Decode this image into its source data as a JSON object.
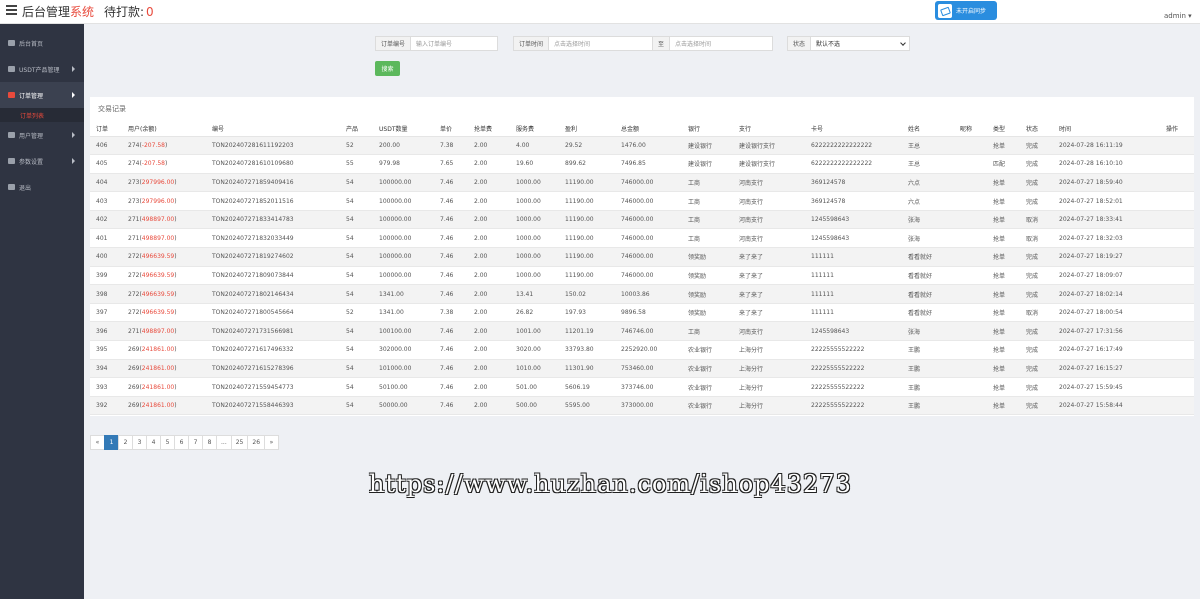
{
  "header": {
    "logo_main": "后台管理",
    "logo_accent": "系统",
    "pending_label": "待打款:",
    "pending_value": "0",
    "sync_label": "未开启同步",
    "user": "admin ▾"
  },
  "sidebar": {
    "items": [
      {
        "label": "后台首页",
        "icon": "home-icon"
      },
      {
        "label": "USDT产品管理",
        "icon": "box-icon"
      },
      {
        "label": "订单管理",
        "icon": "order-icon"
      },
      {
        "label": "用户管理",
        "icon": "user-icon"
      },
      {
        "label": "参数设置",
        "icon": "settings-icon"
      },
      {
        "label": "退出",
        "icon": "logout-icon"
      }
    ],
    "sub_item": "订单列表"
  },
  "filters": {
    "order_no_label": "订单编号",
    "order_no_placeholder": "输入订单编号",
    "time_label": "订单时间",
    "time_start_placeholder": "点击选择时间",
    "time_to_label": "至",
    "time_end_placeholder": "点击选择时间",
    "status_label": "状态",
    "status_value": "默认不选",
    "search_label": "搜索"
  },
  "table": {
    "title": "交易记录",
    "columns": [
      "订单",
      "用户(余额)",
      "编号",
      "产品",
      "USDT数量",
      "单价",
      "抢单费",
      "服务费",
      "盈利",
      "总金额",
      "银行",
      "支行",
      "卡号",
      "姓名",
      "昵称",
      "类型",
      "状态",
      "时间",
      "操作"
    ],
    "rows": [
      {
        "id": "406",
        "user": "274(",
        "balance": "-207.58",
        "close": ")",
        "no": "TON202407281611192203",
        "product": "52",
        "usdt": "200.00",
        "price": "7.38",
        "grab_fee": "2.00",
        "service_fee": "4.00",
        "profit": "29.52",
        "total": "1476.00",
        "bank": "建设银行",
        "branch": "建设银行支行",
        "card": "6222222222222222",
        "name": "王总",
        "nick": "",
        "type": "抢单",
        "status": "完成",
        "time": "2024-07-28 16:11:19",
        "op": ""
      },
      {
        "id": "405",
        "user": "274(",
        "balance": "-207.58",
        "close": ")",
        "no": "TON202407281610109680",
        "product": "55",
        "usdt": "979.98",
        "price": "7.65",
        "grab_fee": "2.00",
        "service_fee": "19.60",
        "profit": "899.62",
        "total": "7496.85",
        "bank": "建设银行",
        "branch": "建设银行支行",
        "card": "6222222222222222",
        "name": "王总",
        "nick": "",
        "type": "匹配",
        "status": "完成",
        "time": "2024-07-28 16:10:10",
        "op": ""
      },
      {
        "id": "404",
        "user": "273(",
        "balance": "297996.00",
        "close": ")",
        "no": "TON202407271859409416",
        "product": "54",
        "usdt": "100000.00",
        "price": "7.46",
        "grab_fee": "2.00",
        "service_fee": "1000.00",
        "profit": "11190.00",
        "total": "746000.00",
        "bank": "工商",
        "branch": "河南支行",
        "card": "369124578",
        "name": "六点",
        "nick": "",
        "type": "抢单",
        "status": "完成",
        "time": "2024-07-27 18:59:40",
        "op": ""
      },
      {
        "id": "403",
        "user": "273(",
        "balance": "297996.00",
        "close": ")",
        "no": "TON202407271852011516",
        "product": "54",
        "usdt": "100000.00",
        "price": "7.46",
        "grab_fee": "2.00",
        "service_fee": "1000.00",
        "profit": "11190.00",
        "total": "746000.00",
        "bank": "工商",
        "branch": "河南支行",
        "card": "369124578",
        "name": "六点",
        "nick": "",
        "type": "抢单",
        "status": "完成",
        "time": "2024-07-27 18:52:01",
        "op": ""
      },
      {
        "id": "402",
        "user": "271(",
        "balance": "498897.00",
        "close": ")",
        "no": "TON202407271833414783",
        "product": "54",
        "usdt": "100000.00",
        "price": "7.46",
        "grab_fee": "2.00",
        "service_fee": "1000.00",
        "profit": "11190.00",
        "total": "746000.00",
        "bank": "工商",
        "branch": "河南支行",
        "card": "1245598643",
        "name": "张海",
        "nick": "",
        "type": "抢单",
        "status": "取消",
        "time": "2024-07-27 18:33:41",
        "op": ""
      },
      {
        "id": "401",
        "user": "271(",
        "balance": "498897.00",
        "close": ")",
        "no": "TON202407271832033449",
        "product": "54",
        "usdt": "100000.00",
        "price": "7.46",
        "grab_fee": "2.00",
        "service_fee": "1000.00",
        "profit": "11190.00",
        "total": "746000.00",
        "bank": "工商",
        "branch": "河南支行",
        "card": "1245598643",
        "name": "张海",
        "nick": "",
        "type": "抢单",
        "status": "取消",
        "time": "2024-07-27 18:32:03",
        "op": ""
      },
      {
        "id": "400",
        "user": "272(",
        "balance": "496639.59",
        "close": ")",
        "no": "TON202407271819274602",
        "product": "54",
        "usdt": "100000.00",
        "price": "7.46",
        "grab_fee": "2.00",
        "service_fee": "1000.00",
        "profit": "11190.00",
        "total": "746000.00",
        "bank": "领奖励",
        "branch": "来了来了",
        "card": "111111",
        "name": "看看就好",
        "nick": "",
        "type": "抢单",
        "status": "完成",
        "time": "2024-07-27 18:19:27",
        "op": ""
      },
      {
        "id": "399",
        "user": "272(",
        "balance": "496639.59",
        "close": ")",
        "no": "TON202407271809073844",
        "product": "54",
        "usdt": "100000.00",
        "price": "7.46",
        "grab_fee": "2.00",
        "service_fee": "1000.00",
        "profit": "11190.00",
        "total": "746000.00",
        "bank": "领奖励",
        "branch": "来了来了",
        "card": "111111",
        "name": "看看就好",
        "nick": "",
        "type": "抢单",
        "status": "完成",
        "time": "2024-07-27 18:09:07",
        "op": ""
      },
      {
        "id": "398",
        "user": "272(",
        "balance": "496639.59",
        "close": ")",
        "no": "TON202407271802146434",
        "product": "54",
        "usdt": "1341.00",
        "price": "7.46",
        "grab_fee": "2.00",
        "service_fee": "13.41",
        "profit": "150.02",
        "total": "10003.86",
        "bank": "领奖励",
        "branch": "来了来了",
        "card": "111111",
        "name": "看看就好",
        "nick": "",
        "type": "抢单",
        "status": "完成",
        "time": "2024-07-27 18:02:14",
        "op": ""
      },
      {
        "id": "397",
        "user": "272(",
        "balance": "496639.59",
        "close": ")",
        "no": "TON202407271800545664",
        "product": "52",
        "usdt": "1341.00",
        "price": "7.38",
        "grab_fee": "2.00",
        "service_fee": "26.82",
        "profit": "197.93",
        "total": "9896.58",
        "bank": "领奖励",
        "branch": "来了来了",
        "card": "111111",
        "name": "看看就好",
        "nick": "",
        "type": "抢单",
        "status": "取消",
        "time": "2024-07-27 18:00:54",
        "op": ""
      },
      {
        "id": "396",
        "user": "271(",
        "balance": "498897.00",
        "close": ")",
        "no": "TON202407271731566981",
        "product": "54",
        "usdt": "100100.00",
        "price": "7.46",
        "grab_fee": "2.00",
        "service_fee": "1001.00",
        "profit": "11201.19",
        "total": "746746.00",
        "bank": "工商",
        "branch": "河南支行",
        "card": "1245598643",
        "name": "张海",
        "nick": "",
        "type": "抢单",
        "status": "完成",
        "time": "2024-07-27 17:31:56",
        "op": ""
      },
      {
        "id": "395",
        "user": "269(",
        "balance": "241861.00",
        "close": ")",
        "no": "TON202407271617496332",
        "product": "54",
        "usdt": "302000.00",
        "price": "7.46",
        "grab_fee": "2.00",
        "service_fee": "3020.00",
        "profit": "33793.80",
        "total": "2252920.00",
        "bank": "农业银行",
        "branch": "上海分行",
        "card": "22225555522222",
        "name": "王鹏",
        "nick": "",
        "type": "抢单",
        "status": "完成",
        "time": "2024-07-27 16:17:49",
        "op": ""
      },
      {
        "id": "394",
        "user": "269(",
        "balance": "241861.00",
        "close": ")",
        "no": "TON202407271615278396",
        "product": "54",
        "usdt": "101000.00",
        "price": "7.46",
        "grab_fee": "2.00",
        "service_fee": "1010.00",
        "profit": "11301.90",
        "total": "753460.00",
        "bank": "农业银行",
        "branch": "上海分行",
        "card": "22225555522222",
        "name": "王鹏",
        "nick": "",
        "type": "抢单",
        "status": "完成",
        "time": "2024-07-27 16:15:27",
        "op": ""
      },
      {
        "id": "393",
        "user": "269(",
        "balance": "241861.00",
        "close": ")",
        "no": "TON202407271559454773",
        "product": "54",
        "usdt": "50100.00",
        "price": "7.46",
        "grab_fee": "2.00",
        "service_fee": "501.00",
        "profit": "5606.19",
        "total": "373746.00",
        "bank": "农业银行",
        "branch": "上海分行",
        "card": "22225555522222",
        "name": "王鹏",
        "nick": "",
        "type": "抢单",
        "status": "完成",
        "time": "2024-07-27 15:59:45",
        "op": ""
      },
      {
        "id": "392",
        "user": "269(",
        "balance": "241861.00",
        "close": ")",
        "no": "TON202407271558446393",
        "product": "54",
        "usdt": "50000.00",
        "price": "7.46",
        "grab_fee": "2.00",
        "service_fee": "500.00",
        "profit": "5595.00",
        "total": "373000.00",
        "bank": "农业银行",
        "branch": "上海分行",
        "card": "22225555522222",
        "name": "王鹏",
        "nick": "",
        "type": "抢单",
        "status": "完成",
        "time": "2024-07-27 15:58:44",
        "op": ""
      }
    ]
  },
  "pagination": [
    "«",
    "1",
    "2",
    "3",
    "4",
    "5",
    "6",
    "7",
    "8",
    "...",
    "25",
    "26",
    "»"
  ],
  "pagination_active": "1",
  "watermark": "https://www.huzhan.com/ishop43273",
  "colors": {
    "accent": "#e84a3c",
    "sidebar": "#2f3442",
    "primary": "#337ab7",
    "search": "#5cb85c"
  }
}
